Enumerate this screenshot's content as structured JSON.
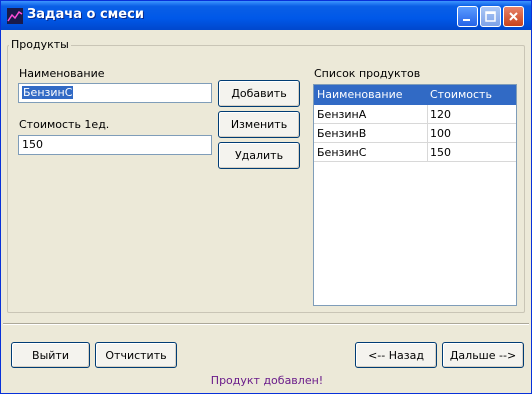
{
  "window": {
    "title": "Задача о смеси",
    "app_icon": "chart-line-icon",
    "controls": [
      "minimize-icon",
      "maximize-icon",
      "close-icon"
    ]
  },
  "group": {
    "label": "Продукты"
  },
  "form": {
    "name_label": "Наименование",
    "name_value": "БензинС",
    "cost_label": "Стоимость 1ед.",
    "cost_value": "150"
  },
  "actions": {
    "add": "Добавить",
    "edit": "Изменить",
    "delete": "Удалить"
  },
  "list": {
    "title": "Список продуктов",
    "columns": [
      "Наименование",
      "Стоимость"
    ],
    "rows": [
      {
        "name": "БензинА",
        "cost": "120"
      },
      {
        "name": "БензинВ",
        "cost": "100"
      },
      {
        "name": "БензинС",
        "cost": "150"
      }
    ]
  },
  "footer": {
    "exit": "Выйти",
    "clear": "Отчистить",
    "back": "<-- Назад",
    "next": "Дальше -->",
    "status": "Продукт добавлен!"
  },
  "colors": {
    "titlebar": "#0058e8",
    "selection": "#316ac5",
    "status_text": "#6a1b8a"
  }
}
